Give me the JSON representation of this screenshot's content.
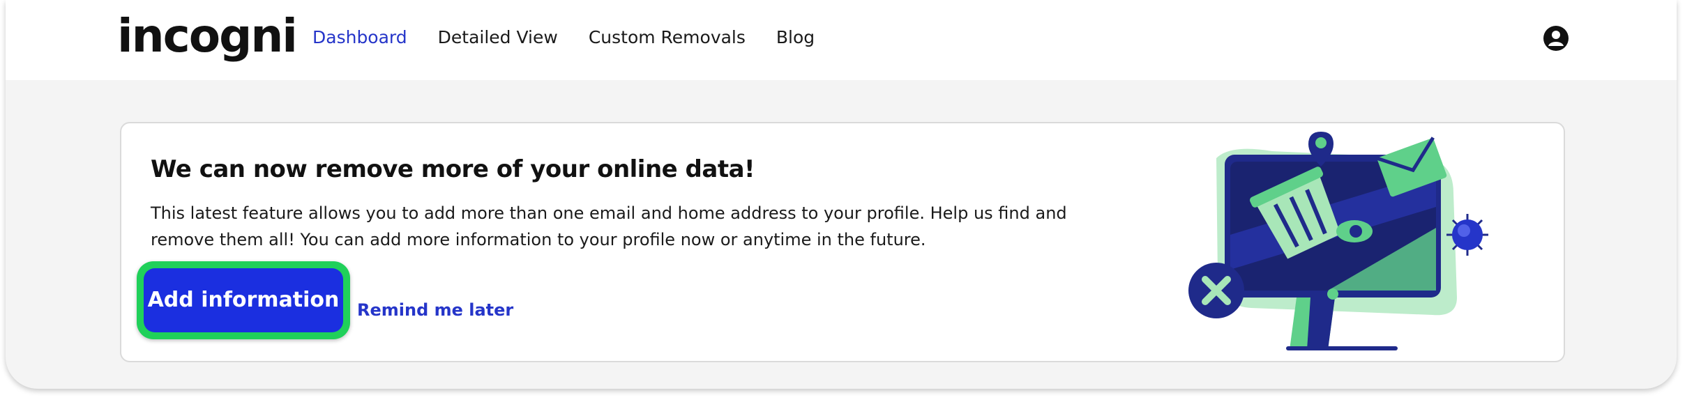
{
  "header": {
    "logo_text": "incogni",
    "nav": [
      {
        "label": "Dashboard",
        "active": true
      },
      {
        "label": "Detailed View",
        "active": false
      },
      {
        "label": "Custom Removals",
        "active": false
      },
      {
        "label": "Blog",
        "active": false
      }
    ],
    "account_icon": "user-circle-icon"
  },
  "banner": {
    "title": "We can now remove more of your online data!",
    "body": "This latest feature allows you to add more than one email and home address to your profile. Help us find and remove them all! You can add more information to your profile now or anytime in the future.",
    "primary_button": "Add information",
    "secondary_link": "Remind me later",
    "illustration_icon": "monitor-data-removal-illustration"
  },
  "colors": {
    "accent": "#2535c9",
    "primary_button": "#1b2fe0",
    "highlight": "#20d05a",
    "illustration_dark": "#1f2a8a",
    "illustration_green": "#5fd08a"
  }
}
